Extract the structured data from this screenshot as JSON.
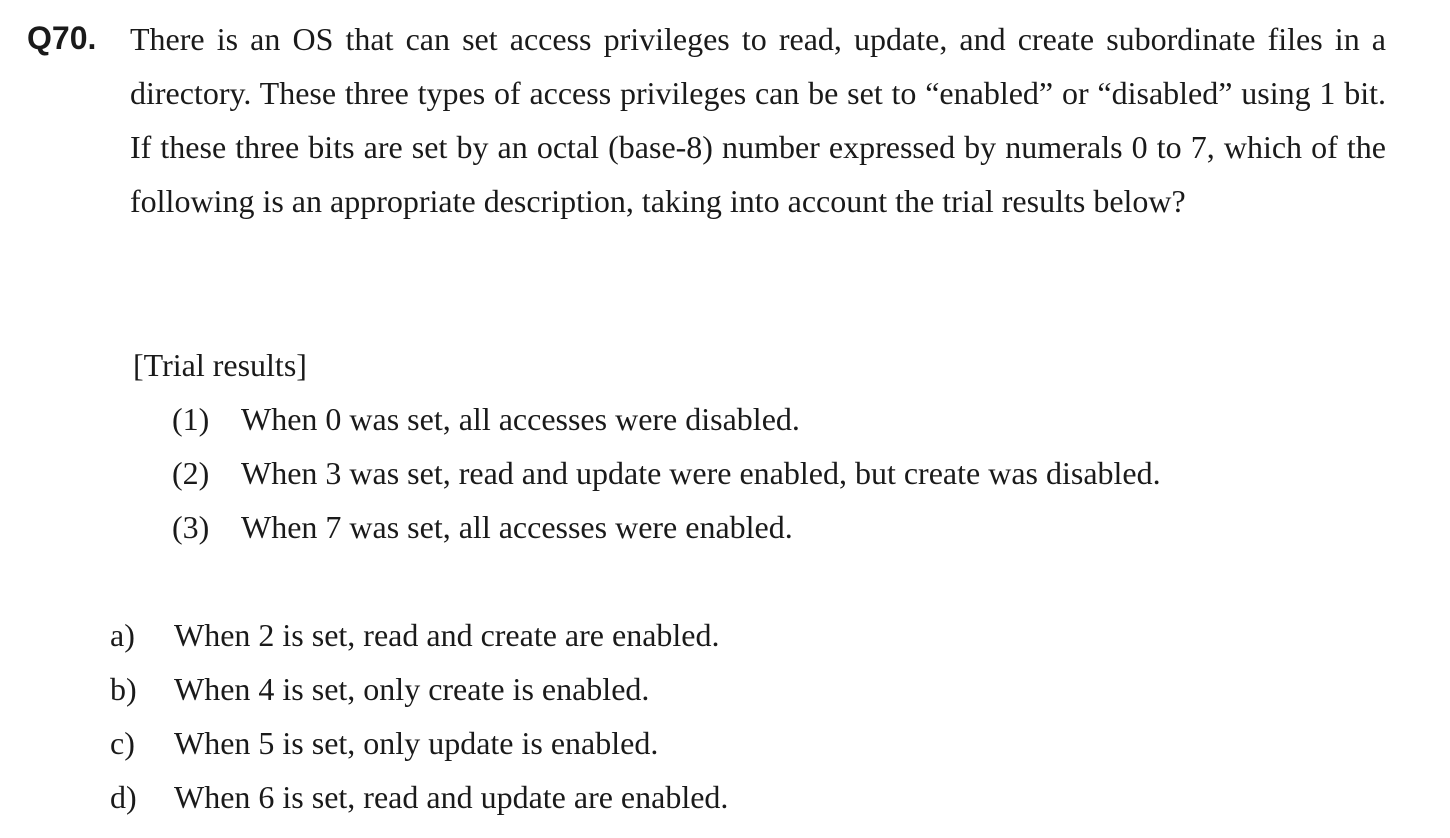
{
  "question": {
    "number": "Q70.",
    "text": "There is an OS that can set access privileges to read, update, and create subordinate files in a directory.  These three types of access privileges can be set to “enabled” or “disabled” using 1 bit.  If these three bits are set by an octal (base-8) number expressed by numerals 0 to 7, which of the following is an appropriate description, taking into account the trial results below?"
  },
  "trial": {
    "heading": "[Trial results]",
    "items": [
      {
        "num": "(1)",
        "text": "When 0 was set, all accesses were disabled."
      },
      {
        "num": "(2)",
        "text": "When 3 was set, read and update were enabled, but create was disabled."
      },
      {
        "num": "(3)",
        "text": "When 7 was set, all accesses were enabled."
      }
    ]
  },
  "options": [
    {
      "letter": "a)",
      "text": "When 2 is set, read and create are enabled."
    },
    {
      "letter": "b)",
      "text": "When 4 is set, only create is enabled."
    },
    {
      "letter": "c)",
      "text": "When 5 is set, only update is enabled."
    },
    {
      "letter": "d)",
      "text": "When 6 is set, read and update are enabled."
    }
  ]
}
